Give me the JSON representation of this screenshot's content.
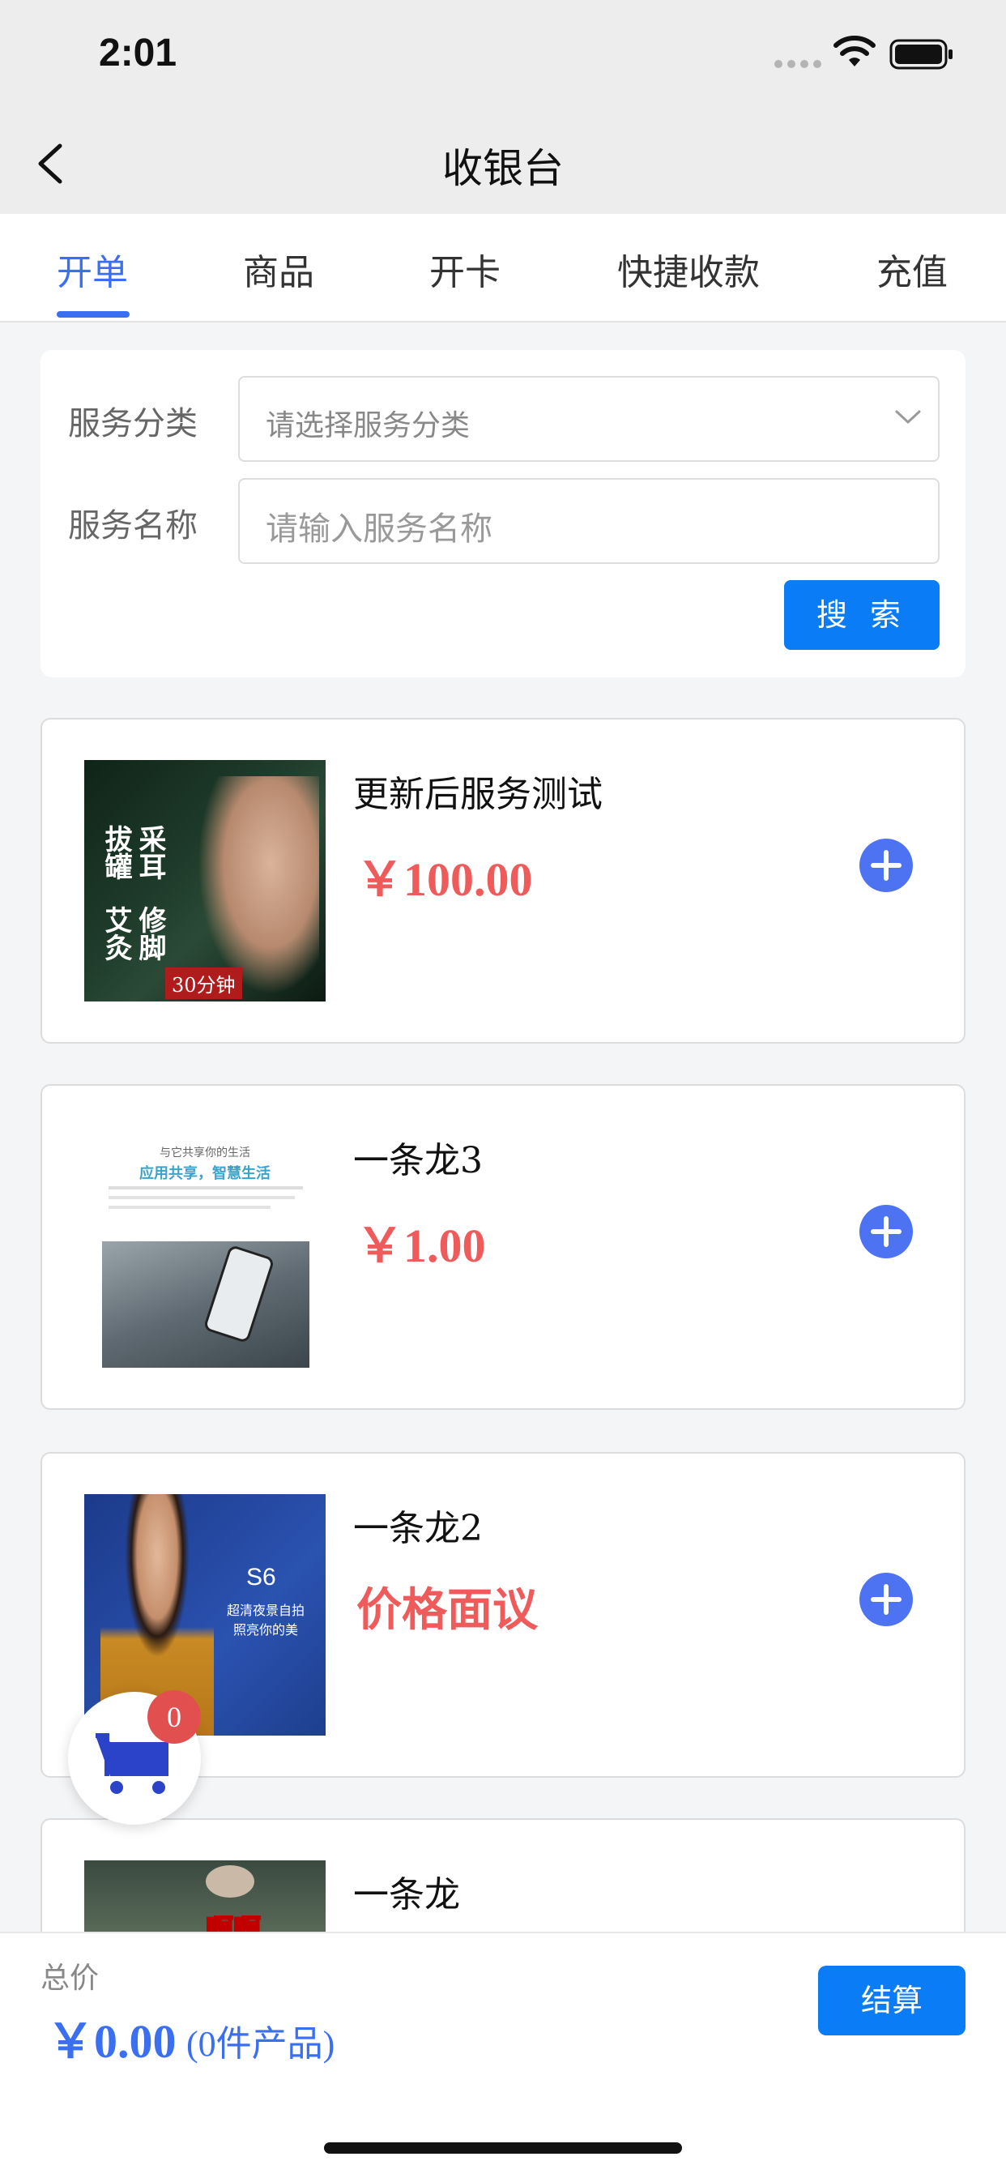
{
  "status": {
    "time": "2:01"
  },
  "nav": {
    "title": "收银台",
    "back_icon": "chevron-left-icon"
  },
  "tabs": [
    {
      "label": "开单",
      "active": true
    },
    {
      "label": "商品",
      "active": false
    },
    {
      "label": "开卡",
      "active": false
    },
    {
      "label": "快捷收款",
      "active": false
    },
    {
      "label": "充值",
      "active": false
    }
  ],
  "filter": {
    "category_label": "服务分类",
    "category_placeholder": "请选择服务分类",
    "name_label": "服务名称",
    "name_placeholder": "请输入服务名称",
    "search_button": "搜 索"
  },
  "products": [
    {
      "name": "更新后服务测试",
      "price": "￥100.00",
      "thumb_text": [
        "采耳",
        "拔罐",
        "修脚",
        "艾灸",
        "30分钟"
      ]
    },
    {
      "name": "一条龙3",
      "price": "￥1.00",
      "thumb_text": [
        "与它共享你的生活",
        "应用共享，智慧生活"
      ]
    },
    {
      "name": "一条龙2",
      "price": "价格面议",
      "thumb_text": [
        "S6",
        "超清夜景自拍",
        "照亮你的美"
      ]
    },
    {
      "name": "一条龙",
      "price": "",
      "thumb_text": [
        "啊啊"
      ]
    }
  ],
  "cart": {
    "count": "0",
    "icon": "cart-icon"
  },
  "bottom": {
    "total_label": "总价",
    "total_price": "￥0.00",
    "total_count": "(0件产品)",
    "checkout_button": "结算"
  },
  "colors": {
    "accent": "#3b6ff2",
    "primary_button": "#0a7cf6",
    "price": "#ef5a5a",
    "badge": "#e24f4f"
  }
}
